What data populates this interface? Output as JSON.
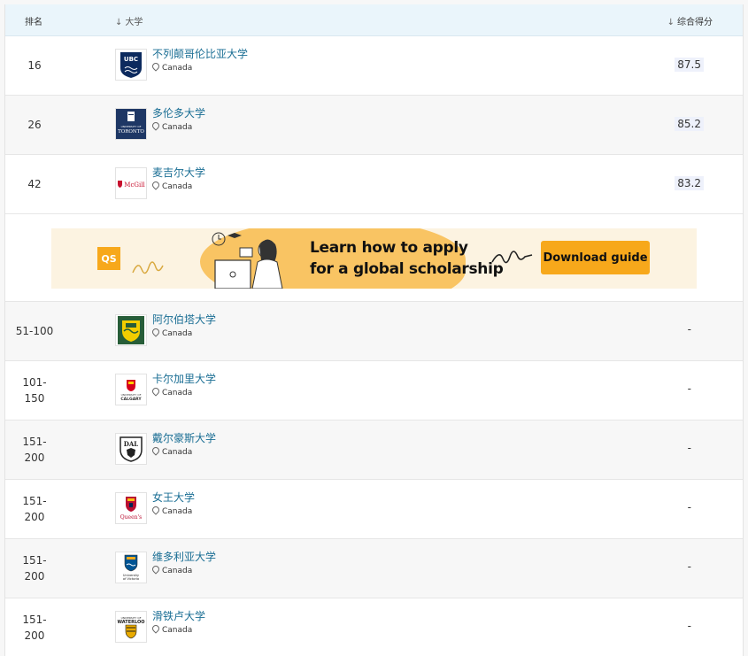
{
  "header": {
    "rank_label": "排名",
    "university_label": "大学",
    "score_label": "综合得分"
  },
  "rows_top": [
    {
      "rank": "16",
      "name": "不列颠哥伦比亚大学",
      "country": "Canada",
      "score": "87.5",
      "logo": "ubc-logo"
    },
    {
      "rank": "26",
      "name": "多伦多大学",
      "country": "Canada",
      "score": "85.2",
      "logo": "toronto-logo"
    },
    {
      "rank": "42",
      "name": "麦吉尔大学",
      "country": "Canada",
      "score": "83.2",
      "logo": "mcgill-logo"
    }
  ],
  "banner": {
    "brand": "QS",
    "line1": "Learn how to apply",
    "line2": "for a global scholarship",
    "button": "Download guide",
    "accent": "#f7a81b"
  },
  "rows_bottom": [
    {
      "rank": "51-100",
      "name": "阿尔伯塔大学",
      "country": "Canada",
      "score": "-",
      "logo": "alberta-logo"
    },
    {
      "rank_a": "101-",
      "rank_b": "150",
      "name": "卡尔加里大学",
      "country": "Canada",
      "score": "-",
      "logo": "calgary-logo"
    },
    {
      "rank_a": "151-",
      "rank_b": "200",
      "name": "戴尔豪斯大学",
      "country": "Canada",
      "score": "-",
      "logo": "dalhousie-logo"
    },
    {
      "rank_a": "151-",
      "rank_b": "200",
      "name": "女王大学",
      "country": "Canada",
      "score": "-",
      "logo": "queens-logo"
    },
    {
      "rank_a": "151-",
      "rank_b": "200",
      "name": "维多利亚大学",
      "country": "Canada",
      "score": "-",
      "logo": "victoria-logo"
    },
    {
      "rank_a": "151-",
      "rank_b": "200",
      "name": "滑铁卢大学",
      "country": "Canada",
      "score": "-",
      "logo": "waterloo-logo"
    }
  ],
  "logo_text": {
    "ubc": "UBC",
    "toronto_small": "UNIVERSITY OF",
    "toronto_big": "TORONTO",
    "mcgill": "McGill",
    "calgary_small": "UNIVERSITY OF",
    "calgary_big": "CALGARY",
    "dal": "DAL",
    "queens": "Queen's",
    "victoria_a": "University",
    "victoria_b": "of Victoria",
    "waterloo_small": "UNIVERSITY OF",
    "waterloo_big": "WATERLOO"
  },
  "colors": {
    "link": "#1a6e94",
    "header_bg": "#eaf5fb",
    "alt_row": "#f7f7f7"
  }
}
